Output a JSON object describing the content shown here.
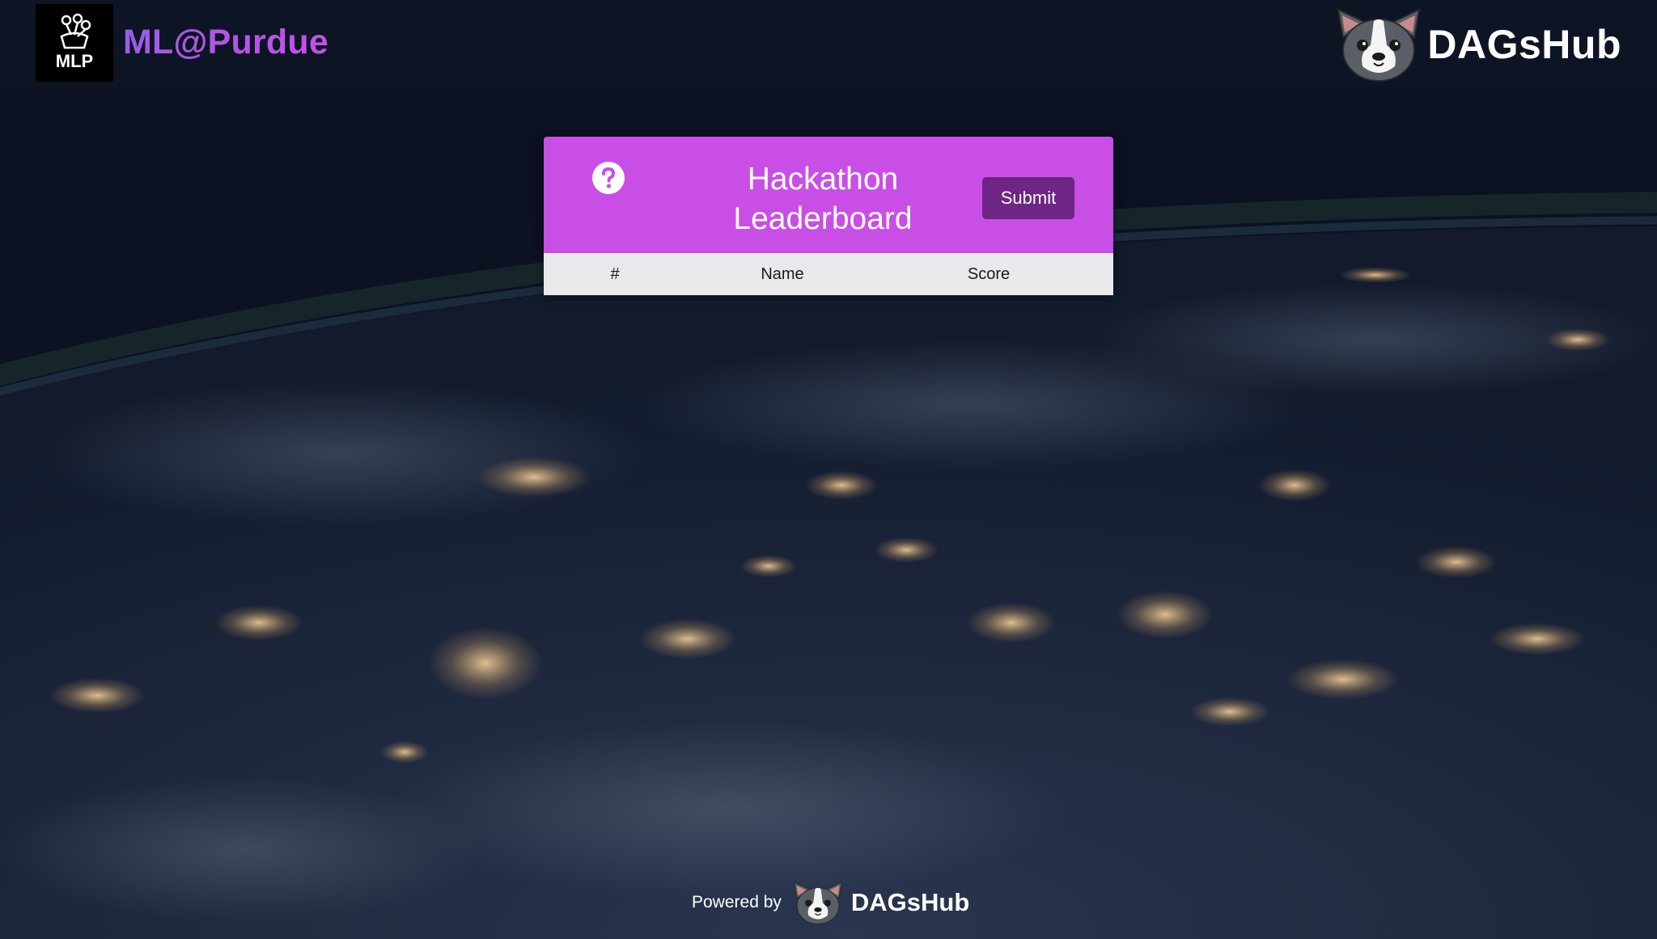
{
  "header": {
    "logo_text": "MLP",
    "brand": "ML@Purdue",
    "partner_logo_text": "DAGsHub"
  },
  "leaderboard": {
    "title_line1": "Hackathon",
    "title_line2": "Leaderboard",
    "help_icon": "question-circle-icon",
    "submit_label": "Submit",
    "columns": [
      "#",
      "Name",
      "Score"
    ],
    "rows": []
  },
  "footer": {
    "powered_by": "Powered by",
    "logo_text": "DAGsHub"
  },
  "colors": {
    "accent": "#c94ee6",
    "submit": "#6e2585",
    "brand_gradient_start": "#9b5de5",
    "brand_gradient_end": "#c650e8",
    "header_bg": "#0d1424",
    "table_header_bg": "#e9e9eb"
  }
}
